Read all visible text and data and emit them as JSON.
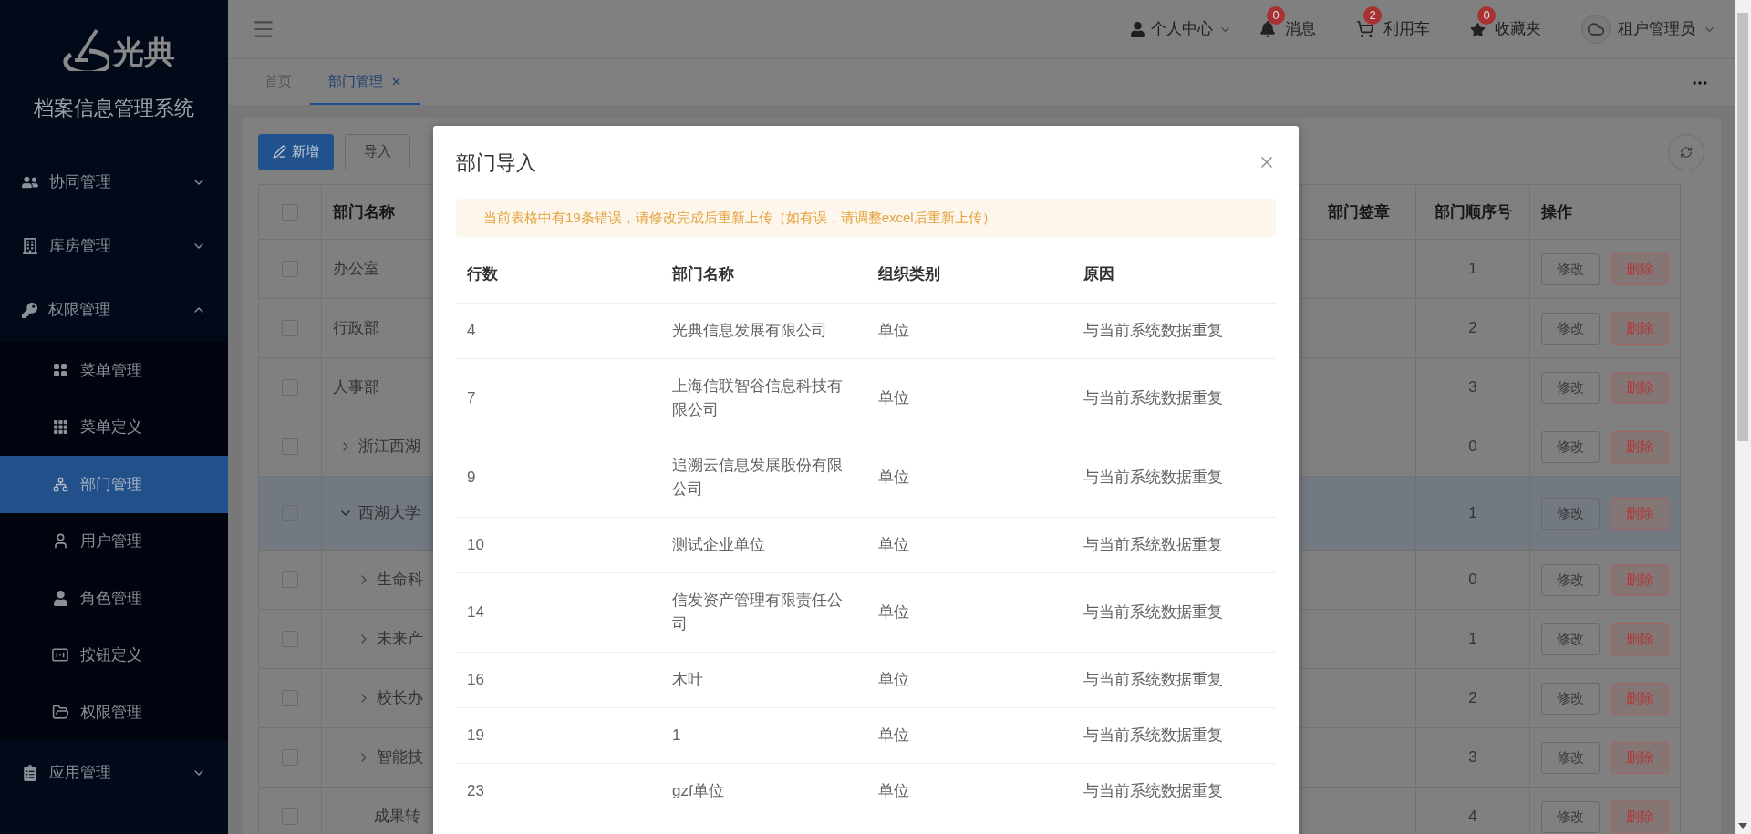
{
  "sidebar": {
    "logo_text": "光典",
    "title": "档案信息管理系统",
    "items": [
      {
        "label": "协同管理",
        "expanded": false
      },
      {
        "label": "库房管理",
        "expanded": false
      },
      {
        "label": "权限管理",
        "expanded": true,
        "children": [
          {
            "label": "菜单管理",
            "selected": false
          },
          {
            "label": "菜单定义",
            "selected": false
          },
          {
            "label": "部门管理",
            "selected": true
          },
          {
            "label": "用户管理",
            "selected": false
          },
          {
            "label": "角色管理",
            "selected": false
          },
          {
            "label": "按钮定义",
            "selected": false
          },
          {
            "label": "权限管理",
            "selected": false
          }
        ]
      },
      {
        "label": "应用管理",
        "expanded": false
      }
    ]
  },
  "header": {
    "user_menu": "个人中心",
    "shortcuts": [
      {
        "label": "消息",
        "count": "0"
      },
      {
        "label": "利用车",
        "count": "2"
      },
      {
        "label": "收藏夹",
        "count": "0"
      }
    ],
    "account": "租户管理员"
  },
  "tabs": [
    {
      "label": "首页",
      "selected": false,
      "closable": false
    },
    {
      "label": "部门管理",
      "selected": true,
      "closable": true
    }
  ],
  "toolbar": {
    "buttons": [
      {
        "label": "新增",
        "kind": "primary"
      },
      {
        "label": "导入",
        "kind": "default"
      }
    ]
  },
  "table": {
    "all_checked": false,
    "columns": [
      "部门名称",
      "部门签章",
      "部门顺序号",
      "操作"
    ],
    "rows": [
      {
        "name": "办公室",
        "order": "1",
        "selected": false,
        "checked": false,
        "has_children": false,
        "actions": [
          {
            "label": "修改",
            "kind": "edit"
          },
          {
            "label": "删除",
            "kind": "delete"
          }
        ]
      },
      {
        "name": "行政部",
        "order": "2",
        "selected": false,
        "checked": false,
        "has_children": false,
        "actions": [
          {
            "label": "修改",
            "kind": "edit"
          },
          {
            "label": "删除",
            "kind": "delete"
          }
        ]
      },
      {
        "name": "人事部",
        "order": "3",
        "selected": false,
        "checked": false,
        "has_children": false,
        "actions": [
          {
            "label": "修改",
            "kind": "edit"
          },
          {
            "label": "删除",
            "kind": "delete"
          }
        ]
      },
      {
        "name": "浙江西湖",
        "order": "0",
        "selected": false,
        "checked": false,
        "has_children": true,
        "expanded": false,
        "actions": [
          {
            "label": "修改",
            "kind": "edit"
          },
          {
            "label": "删除",
            "kind": "delete"
          }
        ]
      },
      {
        "name": "西湖大学",
        "order": "1",
        "selected": true,
        "checked": false,
        "has_children": true,
        "expanded": true,
        "actions": [
          {
            "label": "修改",
            "kind": "edit"
          },
          {
            "label": "删除",
            "kind": "delete"
          }
        ],
        "children": [
          {
            "name": "生命科",
            "order": "0",
            "selected": false,
            "checked": false,
            "has_children": true,
            "expanded": false,
            "actions": [
              {
                "label": "修改",
                "kind": "edit"
              },
              {
                "label": "删除",
                "kind": "delete"
              }
            ]
          },
          {
            "name": "未来产",
            "order": "1",
            "selected": false,
            "checked": false,
            "has_children": true,
            "expanded": false,
            "actions": [
              {
                "label": "修改",
                "kind": "edit"
              },
              {
                "label": "删除",
                "kind": "delete"
              }
            ]
          },
          {
            "name": "校长办",
            "order": "2",
            "selected": false,
            "checked": false,
            "has_children": true,
            "expanded": false,
            "actions": [
              {
                "label": "修改",
                "kind": "edit"
              },
              {
                "label": "删除",
                "kind": "delete"
              }
            ]
          },
          {
            "name": "智能技",
            "order": "3",
            "selected": false,
            "checked": false,
            "has_children": true,
            "expanded": false,
            "actions": [
              {
                "label": "修改",
                "kind": "edit"
              },
              {
                "label": "删除",
                "kind": "delete"
              }
            ]
          },
          {
            "name": "成果转",
            "order": "4",
            "selected": false,
            "checked": false,
            "has_children": false,
            "actions": [
              {
                "label": "修改",
                "kind": "edit"
              },
              {
                "label": "删除",
                "kind": "delete"
              }
            ]
          }
        ]
      }
    ]
  },
  "dialog": {
    "title": "部门导入",
    "alert": "当前表格中有19条错误，请修改完成后重新上传（如有误，请调整excel后重新上传）",
    "columns": [
      "行数",
      "部门名称",
      "组织类别",
      "原因"
    ],
    "rows": [
      [
        "4",
        "光典信息发展有限公司",
        "单位",
        "与当前系统数据重复"
      ],
      [
        "7",
        "上海信联智谷信息科技有限公司",
        "单位",
        "与当前系统数据重复"
      ],
      [
        "9",
        "追溯云信息发展股份有限公司",
        "单位",
        "与当前系统数据重复"
      ],
      [
        "10",
        "测试企业单位",
        "单位",
        "与当前系统数据重复"
      ],
      [
        "14",
        "信发资产管理有限责任公司",
        "单位",
        "与当前系统数据重复"
      ],
      [
        "16",
        "木叶",
        "单位",
        "与当前系统数据重复"
      ],
      [
        "19",
        "1",
        "单位",
        "与当前系统数据重复"
      ],
      [
        "23",
        "gzf单位",
        "单位",
        "与当前系统数据重复"
      ]
    ]
  }
}
